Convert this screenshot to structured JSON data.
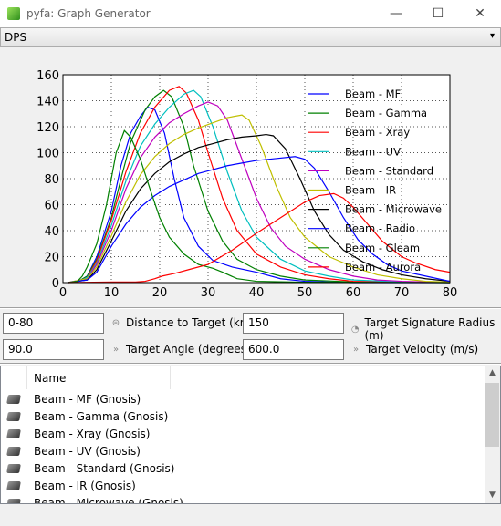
{
  "window": {
    "title": "pyfa: Graph Generator",
    "minimize": "—",
    "maximize": "☐",
    "close": "✕"
  },
  "graph_selector": {
    "value": "DPS"
  },
  "controls": {
    "distance": {
      "value": "0-80",
      "label": "Distance to Target (km)"
    },
    "signature": {
      "value": "150",
      "label": "Target Signature Radius (m)"
    },
    "angle": {
      "value": "90.0",
      "label": "Target Angle (degrees)"
    },
    "velocity": {
      "value": "600.0",
      "label": "Target Velocity (m/s)"
    }
  },
  "list": {
    "header": "Name",
    "items": [
      "Beam - MF (Gnosis)",
      "Beam - Gamma (Gnosis)",
      "Beam - Xray (Gnosis)",
      "Beam - UV (Gnosis)",
      "Beam - Standard (Gnosis)",
      "Beam - IR (Gnosis)",
      "Beam - Microwave (Gnosis)"
    ]
  },
  "chart_data": {
    "type": "line",
    "xlim": [
      0,
      80
    ],
    "ylim": [
      0,
      160
    ],
    "grid": true,
    "legend": "right",
    "xticks": [
      0,
      10,
      20,
      30,
      40,
      50,
      60,
      70,
      80
    ],
    "yticks": [
      0,
      20,
      40,
      60,
      80,
      100,
      120,
      140,
      160
    ],
    "series": [
      {
        "name": "Beam - MF",
        "color": "#0000ff",
        "points": [
          [
            1,
            0
          ],
          [
            3,
            0.5
          ],
          [
            5,
            5
          ],
          [
            7,
            20
          ],
          [
            10,
            55
          ],
          [
            12,
            90
          ],
          [
            14,
            115
          ],
          [
            16,
            128
          ],
          [
            17.5,
            135
          ],
          [
            19,
            133
          ],
          [
            21,
            115
          ],
          [
            23,
            80
          ],
          [
            25,
            50
          ],
          [
            28,
            28
          ],
          [
            31,
            17
          ],
          [
            35,
            12
          ],
          [
            40,
            8
          ],
          [
            45,
            3
          ],
          [
            50,
            1
          ],
          [
            60,
            0
          ],
          [
            80,
            0
          ]
        ]
      },
      {
        "name": "Beam - Gamma",
        "color": "#008000",
        "points": [
          [
            1,
            0
          ],
          [
            3,
            0.5
          ],
          [
            5,
            5
          ],
          [
            7,
            18
          ],
          [
            10,
            50
          ],
          [
            12,
            80
          ],
          [
            14,
            108
          ],
          [
            17,
            133
          ],
          [
            19,
            143
          ],
          [
            20.8,
            148
          ],
          [
            22.5,
            143
          ],
          [
            25,
            120
          ],
          [
            27,
            90
          ],
          [
            30,
            55
          ],
          [
            33,
            32
          ],
          [
            36,
            18
          ],
          [
            40,
            10
          ],
          [
            45,
            5
          ],
          [
            50,
            2
          ],
          [
            60,
            0.5
          ],
          [
            80,
            0
          ]
        ]
      },
      {
        "name": "Beam - Xray",
        "color": "#ff0000",
        "points": [
          [
            1,
            0
          ],
          [
            3,
            0.5
          ],
          [
            5,
            4
          ],
          [
            7,
            17
          ],
          [
            10,
            48
          ],
          [
            13,
            85
          ],
          [
            16,
            115
          ],
          [
            19,
            135
          ],
          [
            22,
            148
          ],
          [
            24,
            151
          ],
          [
            25.5,
            146
          ],
          [
            28,
            125
          ],
          [
            30,
            100
          ],
          [
            33,
            65
          ],
          [
            36,
            40
          ],
          [
            40,
            22
          ],
          [
            45,
            12
          ],
          [
            50,
            6
          ],
          [
            55,
            3
          ],
          [
            60,
            1
          ],
          [
            80,
            0
          ]
        ]
      },
      {
        "name": "Beam - UV",
        "color": "#00bfbf",
        "points": [
          [
            1,
            0
          ],
          [
            3,
            0.5
          ],
          [
            5,
            4
          ],
          [
            7,
            15
          ],
          [
            10,
            44
          ],
          [
            13,
            78
          ],
          [
            16,
            105
          ],
          [
            19,
            122
          ],
          [
            22,
            135
          ],
          [
            25,
            145
          ],
          [
            27,
            148
          ],
          [
            28.5,
            143
          ],
          [
            31,
            120
          ],
          [
            34,
            85
          ],
          [
            37,
            55
          ],
          [
            40,
            35
          ],
          [
            45,
            18
          ],
          [
            50,
            9
          ],
          [
            55,
            5
          ],
          [
            60,
            2
          ],
          [
            70,
            0.5
          ],
          [
            80,
            0
          ]
        ]
      },
      {
        "name": "Beam - Standard",
        "color": "#bf00bf",
        "points": [
          [
            1,
            0
          ],
          [
            5,
            3
          ],
          [
            7,
            14
          ],
          [
            10,
            40
          ],
          [
            13,
            72
          ],
          [
            16,
            96
          ],
          [
            19,
            112
          ],
          [
            22,
            123
          ],
          [
            25,
            130
          ],
          [
            28,
            136
          ],
          [
            30,
            139
          ],
          [
            32,
            136
          ],
          [
            34,
            125
          ],
          [
            37,
            95
          ],
          [
            40,
            65
          ],
          [
            43,
            42
          ],
          [
            46,
            28
          ],
          [
            50,
            18
          ],
          [
            55,
            10
          ],
          [
            60,
            5
          ],
          [
            65,
            2
          ],
          [
            70,
            1
          ],
          [
            80,
            0
          ]
        ]
      },
      {
        "name": "Beam - IR",
        "color": "#bfbf00",
        "points": [
          [
            1,
            0
          ],
          [
            5,
            3
          ],
          [
            7,
            12
          ],
          [
            10,
            36
          ],
          [
            13,
            62
          ],
          [
            16,
            83
          ],
          [
            19,
            97
          ],
          [
            22,
            107
          ],
          [
            25,
            114
          ],
          [
            28,
            119
          ],
          [
            31,
            123
          ],
          [
            34,
            127
          ],
          [
            37,
            129
          ],
          [
            38.5,
            125
          ],
          [
            41,
            105
          ],
          [
            44,
            75
          ],
          [
            47,
            50
          ],
          [
            50,
            35
          ],
          [
            55,
            20
          ],
          [
            60,
            12
          ],
          [
            65,
            6
          ],
          [
            70,
            3
          ],
          [
            75,
            1
          ],
          [
            80,
            0.5
          ]
        ]
      },
      {
        "name": "Beam - Microwave",
        "color": "#000000",
        "points": [
          [
            1,
            0
          ],
          [
            5,
            2
          ],
          [
            7,
            10
          ],
          [
            10,
            32
          ],
          [
            13,
            55
          ],
          [
            16,
            72
          ],
          [
            19,
            84
          ],
          [
            22,
            93
          ],
          [
            25,
            99
          ],
          [
            28,
            104
          ],
          [
            31,
            107
          ],
          [
            34,
            110
          ],
          [
            37,
            112
          ],
          [
            40,
            113
          ],
          [
            42,
            114
          ],
          [
            43.5,
            113
          ],
          [
            46,
            103
          ],
          [
            49,
            80
          ],
          [
            52,
            55
          ],
          [
            55,
            37
          ],
          [
            58,
            25
          ],
          [
            62,
            16
          ],
          [
            66,
            10
          ],
          [
            70,
            6
          ],
          [
            75,
            3
          ],
          [
            80,
            1
          ]
        ]
      },
      {
        "name": "Beam - Radio",
        "color": "#0000ff",
        "points": [
          [
            1,
            0
          ],
          [
            5,
            2
          ],
          [
            7,
            8
          ],
          [
            10,
            28
          ],
          [
            13,
            45
          ],
          [
            16,
            58
          ],
          [
            19,
            67
          ],
          [
            22,
            74
          ],
          [
            25,
            79
          ],
          [
            28,
            84
          ],
          [
            31,
            87
          ],
          [
            34,
            90
          ],
          [
            37,
            92
          ],
          [
            40,
            94
          ],
          [
            44,
            95.5
          ],
          [
            48,
            97
          ],
          [
            50,
            95
          ],
          [
            52,
            88
          ],
          [
            55,
            70
          ],
          [
            58,
            50
          ],
          [
            61,
            33
          ],
          [
            64,
            22
          ],
          [
            67,
            14
          ],
          [
            70,
            9
          ],
          [
            75,
            5
          ],
          [
            80,
            1
          ]
        ]
      },
      {
        "name": "Beam - Gleam",
        "color": "#008000",
        "points": [
          [
            1,
            0
          ],
          [
            3,
            1
          ],
          [
            4,
            5
          ],
          [
            5,
            12
          ],
          [
            7,
            30
          ],
          [
            9,
            60
          ],
          [
            10,
            80
          ],
          [
            11,
            100
          ],
          [
            12,
            110
          ],
          [
            12.7,
            117
          ],
          [
            14,
            112
          ],
          [
            16,
            95
          ],
          [
            18,
            72
          ],
          [
            20,
            50
          ],
          [
            22,
            35
          ],
          [
            25,
            22
          ],
          [
            28,
            14
          ],
          [
            31,
            11
          ],
          [
            33,
            8
          ],
          [
            36,
            3
          ],
          [
            40,
            1
          ],
          [
            50,
            0.3
          ],
          [
            80,
            0
          ]
        ]
      },
      {
        "name": "Beam - Aurora",
        "color": "#ff0000",
        "points": [
          [
            1,
            0
          ],
          [
            10,
            0.5
          ],
          [
            15,
            0.5
          ],
          [
            17,
            1
          ],
          [
            19,
            3
          ],
          [
            20.5,
            5
          ],
          [
            23,
            7
          ],
          [
            26,
            10
          ],
          [
            30,
            14
          ],
          [
            35,
            25
          ],
          [
            40,
            38
          ],
          [
            45,
            50
          ],
          [
            50,
            62
          ],
          [
            53,
            67
          ],
          [
            56,
            68.5
          ],
          [
            58,
            65
          ],
          [
            60,
            58
          ],
          [
            63,
            45
          ],
          [
            66,
            32
          ],
          [
            70,
            20
          ],
          [
            73,
            15
          ],
          [
            77,
            10
          ],
          [
            80,
            8
          ]
        ]
      }
    ]
  }
}
